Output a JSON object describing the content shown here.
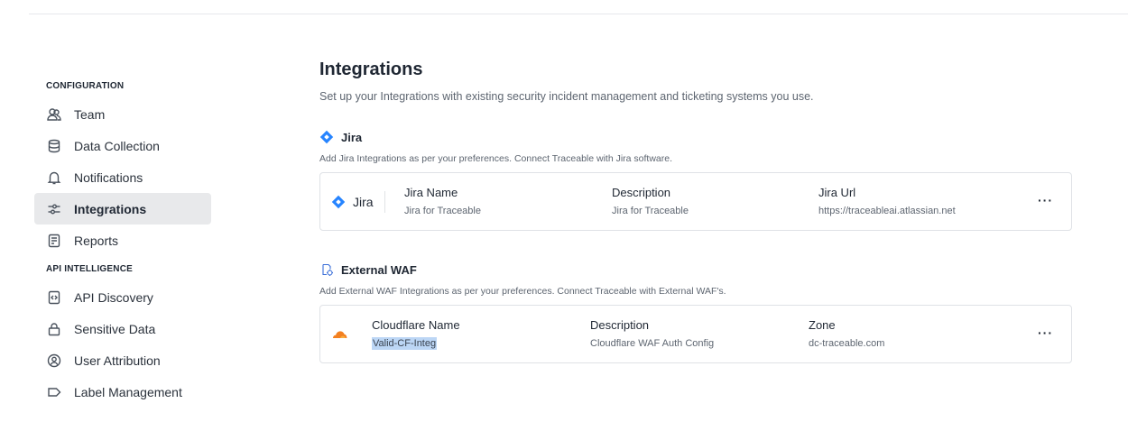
{
  "sidebar": {
    "sections": [
      {
        "label": "CONFIGURATION",
        "items": [
          {
            "label": "Team",
            "icon": "team-icon"
          },
          {
            "label": "Data Collection",
            "icon": "database-icon"
          },
          {
            "label": "Notifications",
            "icon": "bell-icon"
          },
          {
            "label": "Integrations",
            "icon": "integrations-icon",
            "active": true
          },
          {
            "label": "Reports",
            "icon": "report-icon"
          }
        ]
      },
      {
        "label": "API INTELLIGENCE",
        "items": [
          {
            "label": "API Discovery",
            "icon": "api-discovery-icon"
          },
          {
            "label": "Sensitive Data",
            "icon": "lock-icon"
          },
          {
            "label": "User Attribution",
            "icon": "user-circle-icon"
          },
          {
            "label": "Label Management",
            "icon": "label-icon"
          }
        ]
      }
    ]
  },
  "main": {
    "title": "Integrations",
    "subtitle": "Set up your Integrations with existing security incident management and ticketing systems you use."
  },
  "jira": {
    "title": "Jira",
    "description": "Add Jira Integrations as per your preferences. Connect Traceable with Jira software.",
    "card": {
      "badge": "Jira",
      "columns": [
        {
          "header": "Jira Name",
          "value": "Jira for Traceable"
        },
        {
          "header": "Description",
          "value": "Jira for Traceable"
        },
        {
          "header": "Jira Url",
          "value": "https://traceableai.atlassian.net"
        }
      ],
      "more": "···"
    }
  },
  "waf": {
    "title": "External WAF",
    "description": "Add External WAF Integrations as per your preferences. Connect Traceable with External WAF's.",
    "card": {
      "columns": [
        {
          "header": "Cloudflare Name",
          "value": "Valid-CF-Integ"
        },
        {
          "header": "Description",
          "value": "Cloudflare WAF Auth Config"
        },
        {
          "header": "Zone",
          "value": "dc-traceable.com"
        }
      ],
      "more": "···"
    }
  },
  "colors": {
    "jira_blue": "#2684ff",
    "cloudflare_orange": "#f38020",
    "active_bg": "#e8e9eb",
    "selection": "#bcd6f5"
  }
}
